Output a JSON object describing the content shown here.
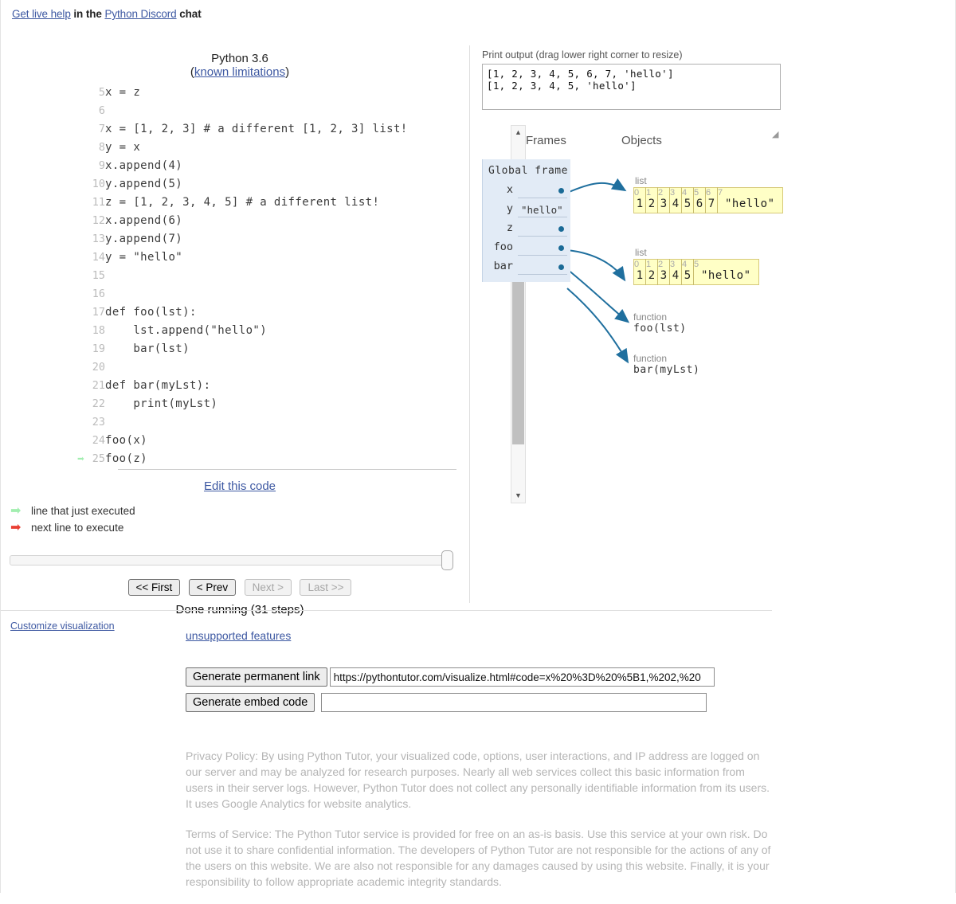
{
  "header": {
    "prefix_link": "Get live help",
    "mid_text": " in the ",
    "second_link": "Python Discord",
    "suffix_text": " chat"
  },
  "editor": {
    "python_version": "Python 3.6",
    "limitations_open_paren": "(",
    "limitations_link": "known limitations",
    "limitations_close_paren": ")",
    "edit_link": "Edit this code",
    "lines": [
      {
        "no": "5",
        "code": "x = z",
        "marker": ""
      },
      {
        "no": "6",
        "code": "",
        "marker": ""
      },
      {
        "no": "7",
        "code": "x = [1, 2, 3] # a different [1, 2, 3] list!",
        "marker": ""
      },
      {
        "no": "8",
        "code": "y = x",
        "marker": ""
      },
      {
        "no": "9",
        "code": "x.append(4)",
        "marker": ""
      },
      {
        "no": "10",
        "code": "y.append(5)",
        "marker": ""
      },
      {
        "no": "11",
        "code": "z = [1, 2, 3, 4, 5] # a different list!",
        "marker": ""
      },
      {
        "no": "12",
        "code": "x.append(6)",
        "marker": ""
      },
      {
        "no": "13",
        "code": "y.append(7)",
        "marker": ""
      },
      {
        "no": "14",
        "code": "y = \"hello\"",
        "marker": ""
      },
      {
        "no": "15",
        "code": "",
        "marker": ""
      },
      {
        "no": "16",
        "code": "",
        "marker": ""
      },
      {
        "no": "17",
        "code": "def foo(lst):",
        "marker": ""
      },
      {
        "no": "18",
        "code": "    lst.append(\"hello\")",
        "marker": ""
      },
      {
        "no": "19",
        "code": "    bar(lst)",
        "marker": ""
      },
      {
        "no": "20",
        "code": "",
        "marker": ""
      },
      {
        "no": "21",
        "code": "def bar(myLst):",
        "marker": ""
      },
      {
        "no": "22",
        "code": "    print(myLst)",
        "marker": ""
      },
      {
        "no": "23",
        "code": "",
        "marker": ""
      },
      {
        "no": "24",
        "code": "foo(x)",
        "marker": ""
      },
      {
        "no": "25",
        "code": "foo(z)",
        "marker": "green"
      }
    ]
  },
  "legend": {
    "executed_label": "line that just executed",
    "next_label": "next line to execute",
    "executed_color": "#a2eeb0",
    "next_color": "#e93f33"
  },
  "controls": {
    "first": "<< First",
    "prev": "< Prev",
    "next": "Next >",
    "last": "Last >>",
    "status": "Done running (31 steps)",
    "customize_link": "Customize visualization"
  },
  "output": {
    "label": "Print output (drag lower right corner to resize)",
    "text": "[1, 2, 3, 4, 5, 6, 7, 'hello']\n[1, 2, 3, 4, 5, 'hello']",
    "resize_grip": "◢"
  },
  "visualization": {
    "frames_heading": "Frames",
    "objects_heading": "Objects",
    "frame": {
      "title": "Global frame",
      "vars": [
        {
          "name": "x",
          "value": "",
          "is_pointer": true
        },
        {
          "name": "y",
          "value": "\"hello\"",
          "is_pointer": false
        },
        {
          "name": "z",
          "value": "",
          "is_pointer": true
        },
        {
          "name": "foo",
          "value": "",
          "is_pointer": true
        },
        {
          "name": "bar",
          "value": "",
          "is_pointer": true
        }
      ]
    },
    "objects": [
      {
        "type": "list",
        "indices": [
          "0",
          "1",
          "2",
          "3",
          "4",
          "5",
          "6",
          "7"
        ],
        "values": [
          "1",
          "2",
          "3",
          "4",
          "5",
          "6",
          "7",
          "\"hello\""
        ]
      },
      {
        "type": "list",
        "indices": [
          "0",
          "1",
          "2",
          "3",
          "4",
          "5"
        ],
        "values": [
          "1",
          "2",
          "3",
          "4",
          "5",
          "\"hello\""
        ]
      }
    ],
    "functions": [
      {
        "type": "function",
        "signature": "foo(lst)"
      },
      {
        "type": "function",
        "signature": "bar(myLst)"
      }
    ],
    "colors": {
      "frame_bg": "#e2ebf6",
      "list_bg": "#ffffc6",
      "list_border": "#d6c97a",
      "pointer": "#1a6a96"
    }
  },
  "bottom": {
    "unsupported_link": "unsupported features",
    "permalink_button": "Generate permanent link",
    "permalink_value": "https://pythontutor.com/visualize.html#code=x%20%3D%20%5B1,%202,%20",
    "embed_button": "Generate embed code",
    "embed_value": "",
    "privacy": "Privacy Policy: By using Python Tutor, your visualized code, options, user interactions, and IP address are logged on our server and may be analyzed for research purposes. Nearly all web services collect this basic information from users in their server logs. However, Python Tutor does not collect any personally identifiable information from its users. It uses Google Analytics for website analytics.",
    "terms": "Terms of Service: The Python Tutor service is provided for free on an as-is basis. Use this service at your own risk. Do not use it to share confidential information. The developers of Python Tutor are not responsible for the actions of any of the users on this website. We are also not responsible for any damages caused by using this website. Finally, it is your responsibility to follow appropriate academic integrity standards."
  }
}
